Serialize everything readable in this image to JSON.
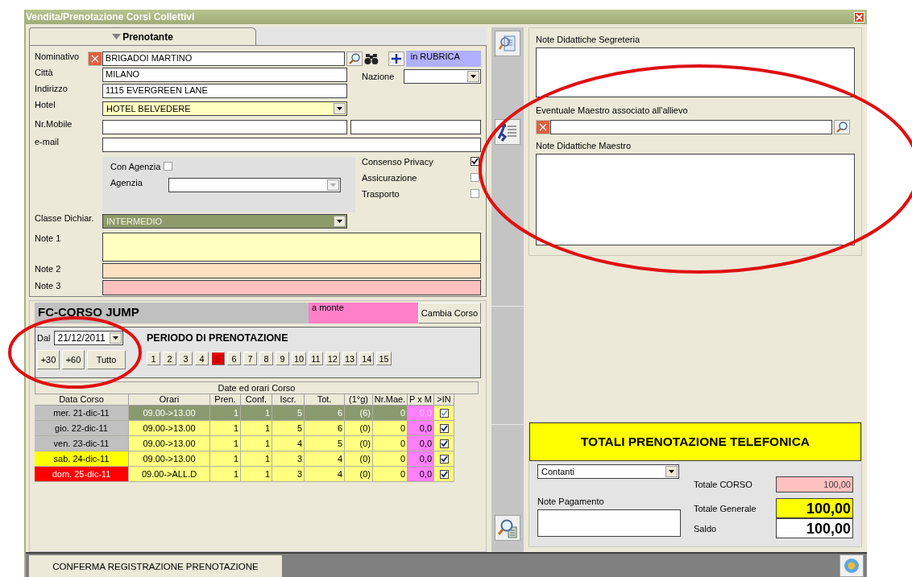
{
  "window": {
    "title": "Vendita/Prenotazione  Corsi Collettivi"
  },
  "tab": {
    "label": "Prenotante"
  },
  "prenotante": {
    "nominativo": {
      "label": "Nominativo",
      "value": "BRIGADOI MARTINO",
      "rubrica": "in RUBRICA"
    },
    "citta": {
      "label": "Città",
      "value": "MILANO"
    },
    "nazione": {
      "label": "Nazione"
    },
    "indirizzo": {
      "label": "Indirizzo",
      "value": "1115 EVERGREEN LANE"
    },
    "hotel": {
      "label": "Hotel",
      "value": "HOTEL BELVEDERE"
    },
    "mobile": {
      "label": "Nr.Mobile"
    },
    "email": {
      "label": "e-mail"
    },
    "agenzia": {
      "toggle_label": "Con Agenzia",
      "checked": false,
      "label": "Agenzia"
    },
    "options": [
      {
        "label": "Consenso Privacy",
        "checked": true
      },
      {
        "label": "Assicurazione",
        "checked": false
      },
      {
        "label": "Trasporto",
        "checked": false
      }
    ],
    "classe": {
      "label": "Classe Dichiar.",
      "value": "INTERMEDIO"
    },
    "notes": [
      {
        "label": "Note 1",
        "color": "#ffffc0"
      },
      {
        "label": "Note 2",
        "color": "#fde0c0"
      },
      {
        "label": "Note 3",
        "color": "#ffc0c0"
      }
    ]
  },
  "course": {
    "title": "FC-CORSO JUMP",
    "status": "a monte",
    "change_button": "Cambia Corso",
    "from_label": "Dal",
    "from_date": "21/12/2011",
    "range_buttons": [
      "+30",
      "+60",
      "Tutto"
    ],
    "period_title": "PERIODO DI PRENOTAZIONE",
    "days": [
      {
        "label": "1",
        "selected": false
      },
      {
        "label": "2",
        "selected": false
      },
      {
        "label": "3",
        "selected": false
      },
      {
        "label": "4",
        "selected": false
      },
      {
        "label": "5",
        "selected": true
      },
      {
        "label": "6",
        "selected": false
      },
      {
        "label": "7",
        "selected": false
      },
      {
        "label": "8",
        "selected": false
      },
      {
        "label": "9",
        "selected": false
      },
      {
        "label": "10",
        "selected": false
      },
      {
        "label": "11",
        "selected": false
      },
      {
        "label": "12",
        "selected": false
      },
      {
        "label": "13",
        "selected": false
      },
      {
        "label": "14",
        "selected": false
      },
      {
        "label": "15",
        "selected": false
      }
    ]
  },
  "schedule": {
    "caption": "Date ed orari Corso",
    "columns": [
      "Data Corso",
      "Orari",
      "Pren.",
      "Conf.",
      "Iscr.",
      "Tot.",
      "(1°g)",
      "Nr.Mae.",
      "P x M",
      ">IN"
    ],
    "rows": [
      {
        "color": "#c0c0c0",
        "selected": true,
        "cells": [
          "mer. 21-dic-11",
          "09.00->13.00",
          "1",
          "1",
          "5",
          "6",
          "(6)",
          "0",
          "0,0"
        ],
        "in_checked": true
      },
      {
        "color": "#c0c0c0",
        "selected": false,
        "cells": [
          "gio. 22-dic-11",
          "09.00->13.00",
          "1",
          "1",
          "5",
          "6",
          "(0)",
          "0",
          "0,0"
        ],
        "in_checked": true
      },
      {
        "color": "#c0c0c0",
        "selected": false,
        "cells": [
          "ven. 23-dic-11",
          "09.00->13.00",
          "1",
          "1",
          "4",
          "5",
          "(0)",
          "0",
          "0,0"
        ],
        "in_checked": true
      },
      {
        "color": "#ffff00",
        "selected": false,
        "cells": [
          "sab. 24-dic-11",
          "09.00->13.00",
          "1",
          "1",
          "3",
          "4",
          "(0)",
          "0",
          "0,0"
        ],
        "in_checked": true
      },
      {
        "color": "#ff0000",
        "selected": false,
        "cells": [
          "dom. 25-dic-11",
          "09.00->ALL.D",
          "1",
          "1",
          "3",
          "4",
          "(0)",
          "0",
          "0,0"
        ],
        "in_checked": true
      }
    ]
  },
  "didattica": {
    "segreteria_label": "Note Didattiche Segreteria",
    "maestro_label": "Eventuale Maestro associato all'allievo",
    "maestro_notes_label": "Note Didattiche Maestro"
  },
  "totals": {
    "title": "TOTALI PRENOTAZIONE TELEFONICA",
    "payment": "Contanti",
    "payment_notes_label": "Note Pagamento",
    "rows": [
      {
        "label": "Totale CORSO",
        "value": "100,00",
        "kind": "small"
      },
      {
        "label": "Totale Generale",
        "value": "100,00",
        "kind": "highlight"
      },
      {
        "label": "Saldo",
        "value": "100,00",
        "kind": "big"
      }
    ]
  },
  "confirm_button": "CONFERMA REGISTRAZIONE PRENOTAZIONE"
}
